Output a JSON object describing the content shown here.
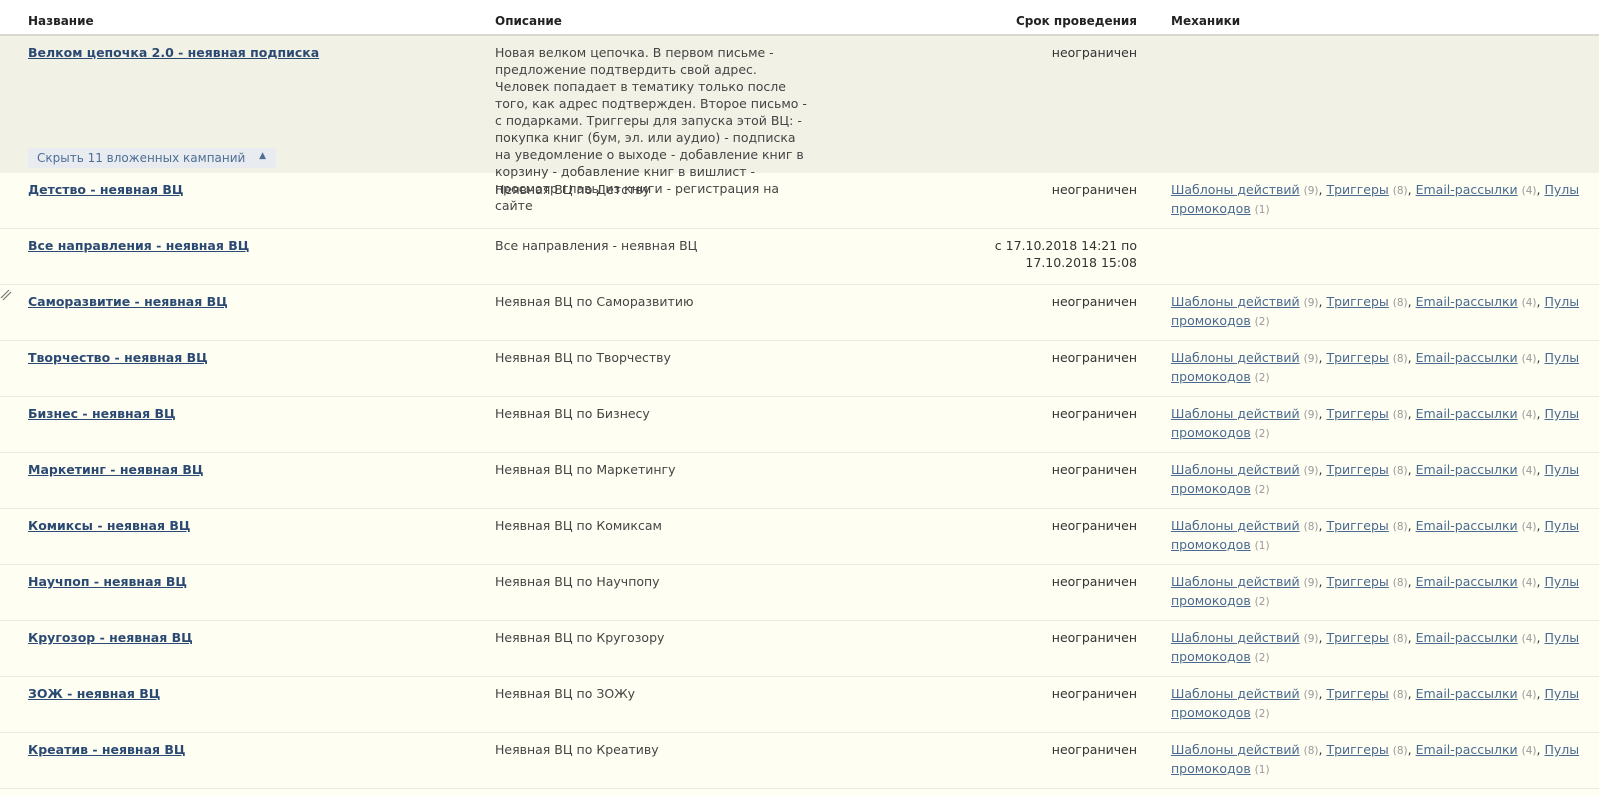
{
  "header": {
    "name": "Название",
    "description": "Описание",
    "period": "Срок проведения",
    "mechanics": "Механики"
  },
  "parent": {
    "name": "Велком цепочка 2.0 - неявная подписка",
    "description": "Новая велком цепочка. В первом письме - предложение подтвердить свой адрес. Человек попадает в тематику только после того, как адрес подтвержден. Второе письмо - с подарками. Триггеры для запуска этой ВЦ: - покупка книг (бум, эл. или аудио) - подписка на уведомление о выходе - добавление книг в корзину - добавление книг в вишлист - просмотр главы из книги - регистрация на сайте",
    "period": "неограничен",
    "collapse_label": "Скрыть 11 вложенных кампаний"
  },
  "mech_labels": {
    "templates": "Шаблоны действий",
    "triggers": "Триггеры",
    "emails": "Email-рассылки",
    "pools_1": "Пулы",
    "pools_2": "промокодов"
  },
  "rows": [
    {
      "name": "Детство - неявная ВЦ",
      "description": "Неявная ВЦ по Детству",
      "period": "неограничен",
      "t": "(9)",
      "tr": "(8)",
      "e": "(4)",
      "p": "(1)"
    },
    {
      "name": "Все направления - неявная ВЦ",
      "description": "Все направления - неявная ВЦ",
      "period_1": "с 17.10.2018 14:21 по",
      "period_2": "17.10.2018 15:08"
    },
    {
      "name": "Саморазвитие - неявная ВЦ",
      "description": "Неявная ВЦ по Саморазвитию",
      "period": "неограничен",
      "t": "(9)",
      "tr": "(8)",
      "e": "(4)",
      "p": "(2)"
    },
    {
      "name": "Творчество - неявная ВЦ",
      "description": "Неявная ВЦ по Творчеству",
      "period": "неограничен",
      "t": "(9)",
      "tr": "(8)",
      "e": "(4)",
      "p": "(2)"
    },
    {
      "name": "Бизнес - неявная ВЦ",
      "description": "Неявная ВЦ по Бизнесу",
      "period": "неограничен",
      "t": "(9)",
      "tr": "(8)",
      "e": "(4)",
      "p": "(2)"
    },
    {
      "name": "Маркетинг - неявная ВЦ",
      "description": "Неявная ВЦ по Маркетингу",
      "period": "неограничен",
      "t": "(9)",
      "tr": "(8)",
      "e": "(4)",
      "p": "(2)"
    },
    {
      "name": "Комиксы - неявная ВЦ",
      "description": "Неявная ВЦ по Комиксам",
      "period": "неограничен",
      "t": "(8)",
      "tr": "(8)",
      "e": "(4)",
      "p": "(1)"
    },
    {
      "name": "Научпоп - неявная ВЦ",
      "description": "Неявная ВЦ по Научпопу",
      "period": "неограничен",
      "t": "(9)",
      "tr": "(8)",
      "e": "(4)",
      "p": "(2)"
    },
    {
      "name": "Кругозор - неявная ВЦ",
      "description": "Неявная ВЦ по Кругозору",
      "period": "неограничен",
      "t": "(9)",
      "tr": "(8)",
      "e": "(4)",
      "p": "(2)"
    },
    {
      "name": "ЗОЖ - неявная ВЦ",
      "description": "Неявная ВЦ по ЗОЖу",
      "period": "неограничен",
      "t": "(9)",
      "tr": "(8)",
      "e": "(4)",
      "p": "(2)"
    },
    {
      "name": "Креатив - неявная ВЦ",
      "description": "Неявная ВЦ по Креативу",
      "period": "неограничен",
      "t": "(8)",
      "tr": "(8)",
      "e": "(4)",
      "p": "(1)"
    }
  ]
}
